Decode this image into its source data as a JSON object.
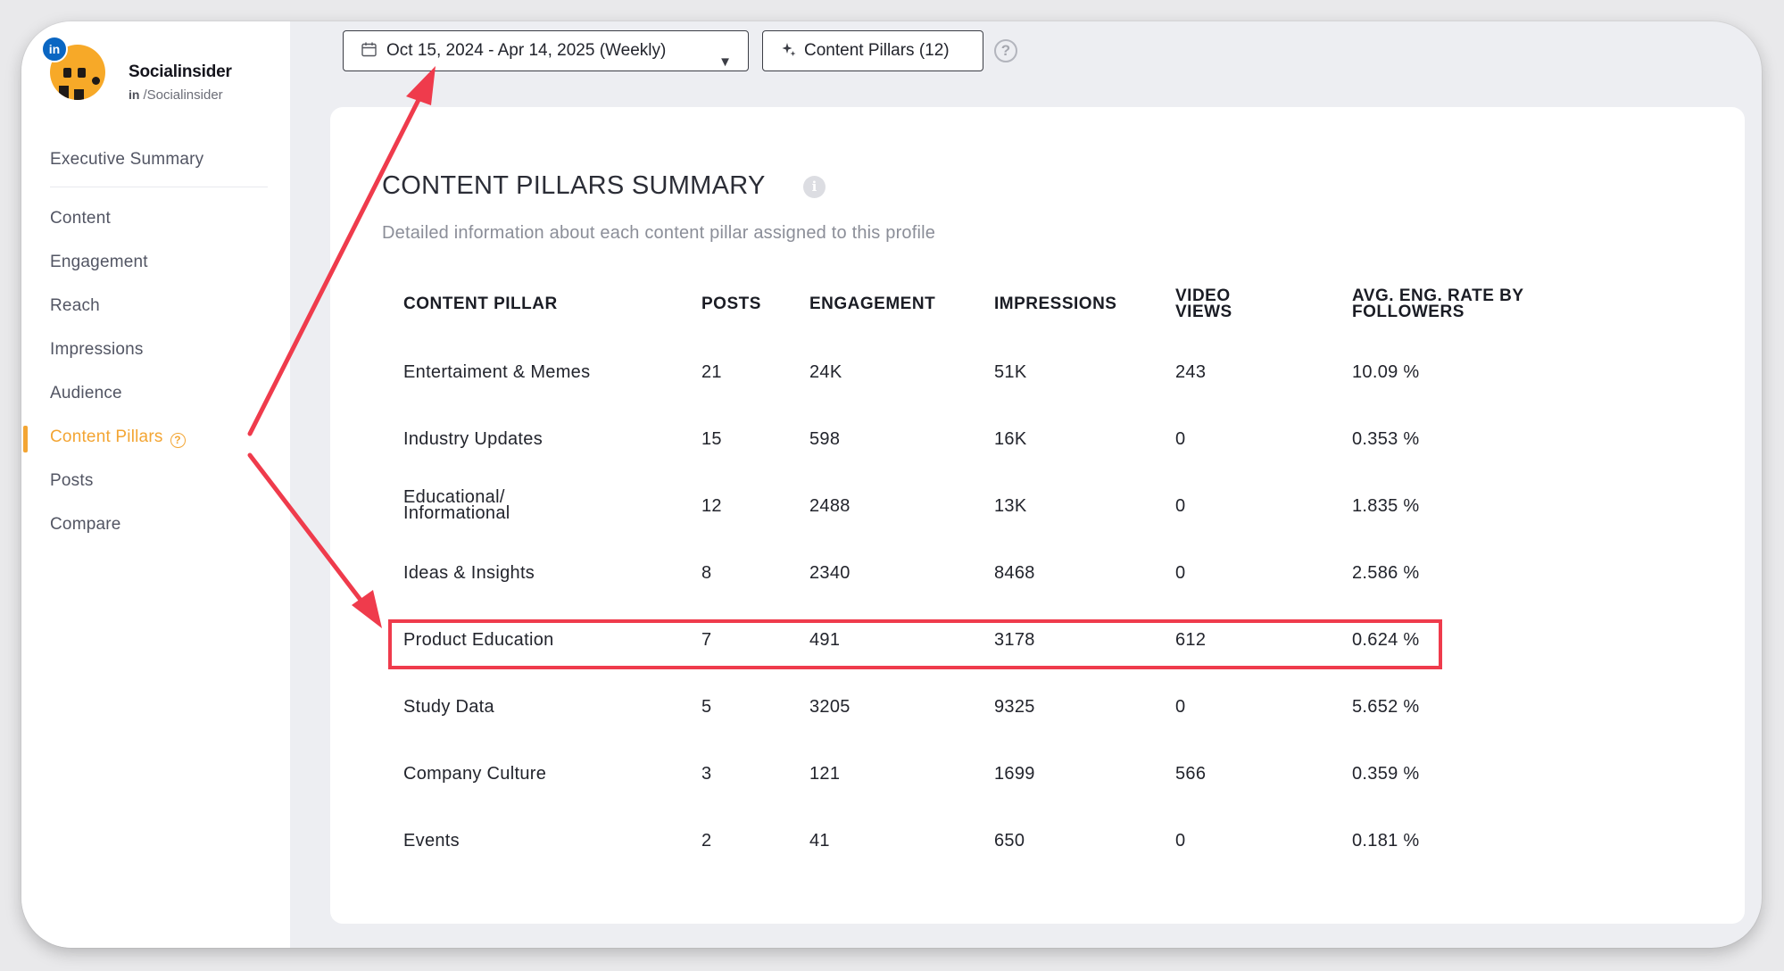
{
  "profile": {
    "badge": "in",
    "name": "Socialinsider",
    "handle_prefix": "in",
    "handle": "/Socialinsider"
  },
  "nav": {
    "items": [
      {
        "label": "Executive Summary"
      },
      {
        "label": "Content"
      },
      {
        "label": "Engagement"
      },
      {
        "label": "Reach"
      },
      {
        "label": "Impressions"
      },
      {
        "label": "Audience"
      },
      {
        "label": "Content Pillars",
        "active": true
      },
      {
        "label": "Posts"
      },
      {
        "label": "Compare"
      }
    ],
    "help_glyph": "?"
  },
  "toolbar": {
    "date_range": "Oct 15, 2024 - Apr 14, 2025 (Weekly)",
    "date_icon": "calendar-icon",
    "pillars_label": "Content Pillars (12)",
    "pillars_icon": "sparkle-icon",
    "help_glyph": "?"
  },
  "card": {
    "title": "CONTENT PILLARS SUMMARY",
    "info_glyph": "i",
    "subtitle": "Detailed information about each content pillar assigned to this profile"
  },
  "table": {
    "headers": {
      "pillar": "CONTENT PILLAR",
      "posts": "POSTS",
      "engagement": "ENGAGEMENT",
      "impressions": "IMPRESSIONS",
      "video_views_1": "VIDEO",
      "video_views_2": "VIEWS",
      "avg_rate_1": "AVG. ENG. RATE BY",
      "avg_rate_2": "FOLLOWERS"
    },
    "rows": [
      {
        "pillar": "Entertaiment & Memes",
        "posts": "21",
        "engagement": "24K",
        "impressions": "51K",
        "video_views": "243",
        "avg_rate": "10.09 %"
      },
      {
        "pillar": "Industry Updates",
        "posts": "15",
        "engagement": "598",
        "impressions": "16K",
        "video_views": "0",
        "avg_rate": "0.353 %"
      },
      {
        "pillar_1": "Educational/",
        "pillar_2": "Informational",
        "posts": "12",
        "engagement": "2488",
        "impressions": "13K",
        "video_views": "0",
        "avg_rate": "1.835 %"
      },
      {
        "pillar": "Ideas & Insights",
        "posts": "8",
        "engagement": "2340",
        "impressions": "8468",
        "video_views": "0",
        "avg_rate": "2.586 %"
      },
      {
        "pillar": "Product Education",
        "posts": "7",
        "engagement": "491",
        "impressions": "3178",
        "video_views": "612",
        "avg_rate": "0.624 %",
        "highlighted": true
      },
      {
        "pillar": "Study Data",
        "posts": "5",
        "engagement": "3205",
        "impressions": "9325",
        "video_views": "0",
        "avg_rate": "5.652 %"
      },
      {
        "pillar": "Company Culture",
        "posts": "3",
        "engagement": "121",
        "impressions": "1699",
        "video_views": "566",
        "avg_rate": "0.359 %"
      },
      {
        "pillar": "Events",
        "posts": "2",
        "engagement": "41",
        "impressions": "650",
        "video_views": "0",
        "avg_rate": "0.181 %"
      }
    ]
  },
  "annotations": {
    "arrow_color": "#ef3b4c",
    "highlight_color": "#ef3b4c"
  },
  "colors": {
    "accent": "#f3a533",
    "linkedin": "#0a66c2"
  }
}
